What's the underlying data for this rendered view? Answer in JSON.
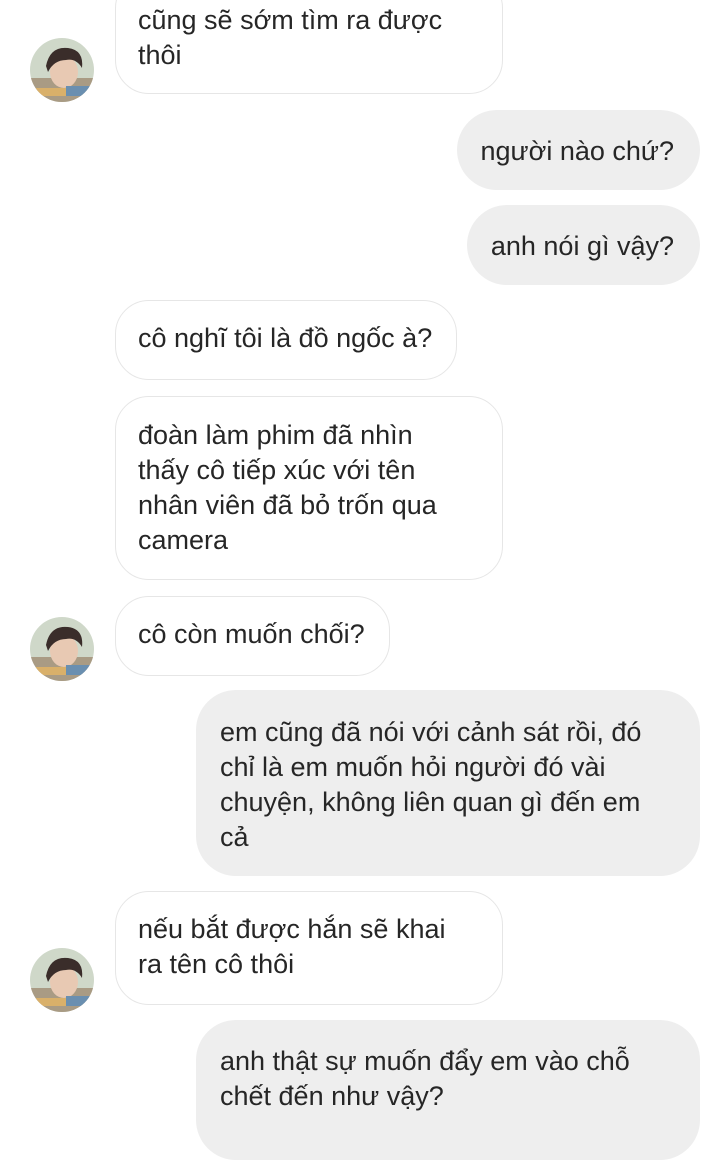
{
  "messages": [
    {
      "from": "other",
      "text": "cũng sẽ sớm tìm ra được\nthôi"
    },
    {
      "from": "me",
      "text": "người nào chứ?"
    },
    {
      "from": "me",
      "text": "anh nói gì vậy?"
    },
    {
      "from": "other",
      "text": "cô nghĩ tôi là đồ ngốc à?"
    },
    {
      "from": "other",
      "text": "đoàn làm phim đã nhìn\nthấy cô tiếp xúc với tên\nnhân viên đã bỏ trốn qua\ncamera"
    },
    {
      "from": "other",
      "text": "cô còn muốn chối?"
    },
    {
      "from": "me",
      "text": "em cũng đã nói với cảnh sát rồi, đó\nchỉ là em muốn hỏi người đó vài\nchuyện, không liên quan gì đến em\ncả"
    },
    {
      "from": "other",
      "text": "nếu bắt được hắn sẽ khai\nra tên cô thôi"
    },
    {
      "from": "me",
      "text": "anh thật sự muốn đẩy em vào chỗ\nchết đến như vậy?"
    }
  ],
  "avatar_icon": "user-avatar-photo",
  "colors": {
    "incoming_bg": "#ffffff",
    "incoming_border": "#e6e6e6",
    "outgoing_bg": "#eeeeee",
    "text": "#262626"
  }
}
